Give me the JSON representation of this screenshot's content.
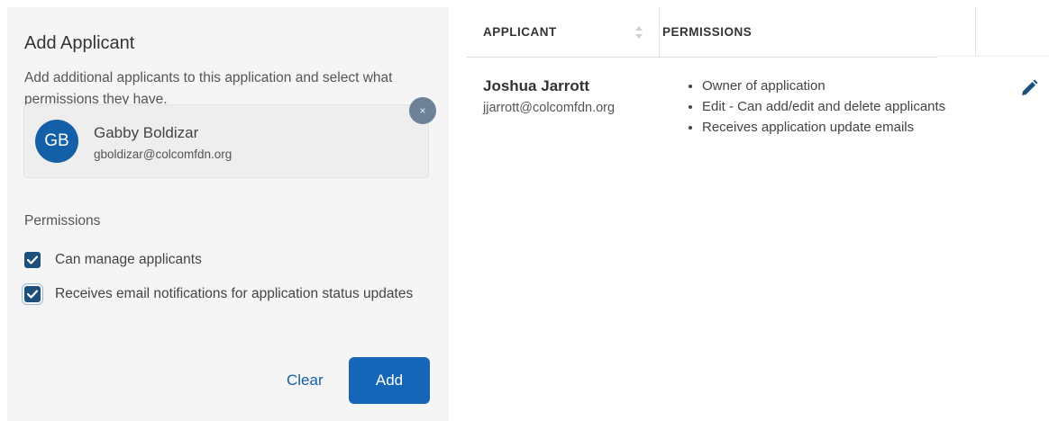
{
  "add_panel": {
    "title": "Add Applicant",
    "description": "Add additional applicants to this application and select what permissions they have.",
    "selected_applicant": {
      "initials": "GB",
      "name": "Gabby Boldizar",
      "email": "gboldizar@colcomfdn.org",
      "avatar_color": "#1460a8"
    },
    "remove_label": "×",
    "permissions_heading": "Permissions",
    "permissions": [
      {
        "label": "Can manage applicants",
        "checked": true
      },
      {
        "label": "Receives email notifications for application status updates",
        "checked": true
      }
    ],
    "clear_label": "Clear",
    "add_label": "Add"
  },
  "table": {
    "columns": [
      "APPLICANT",
      "PERMISSIONS"
    ],
    "rows": [
      {
        "name": "Joshua Jarrott",
        "email": "jjarrott@colcomfdn.org",
        "permissions": [
          "Owner of application",
          "Edit - Can add/edit and delete applicants",
          "Receives application update emails"
        ]
      }
    ]
  },
  "icons": {
    "sort": "sort-icon",
    "edit": "pencil-icon",
    "check": "check-icon"
  },
  "colors": {
    "accent": "#1565b8",
    "checkbox": "#1c4f7c",
    "panel_bg": "#f5f5f5"
  }
}
